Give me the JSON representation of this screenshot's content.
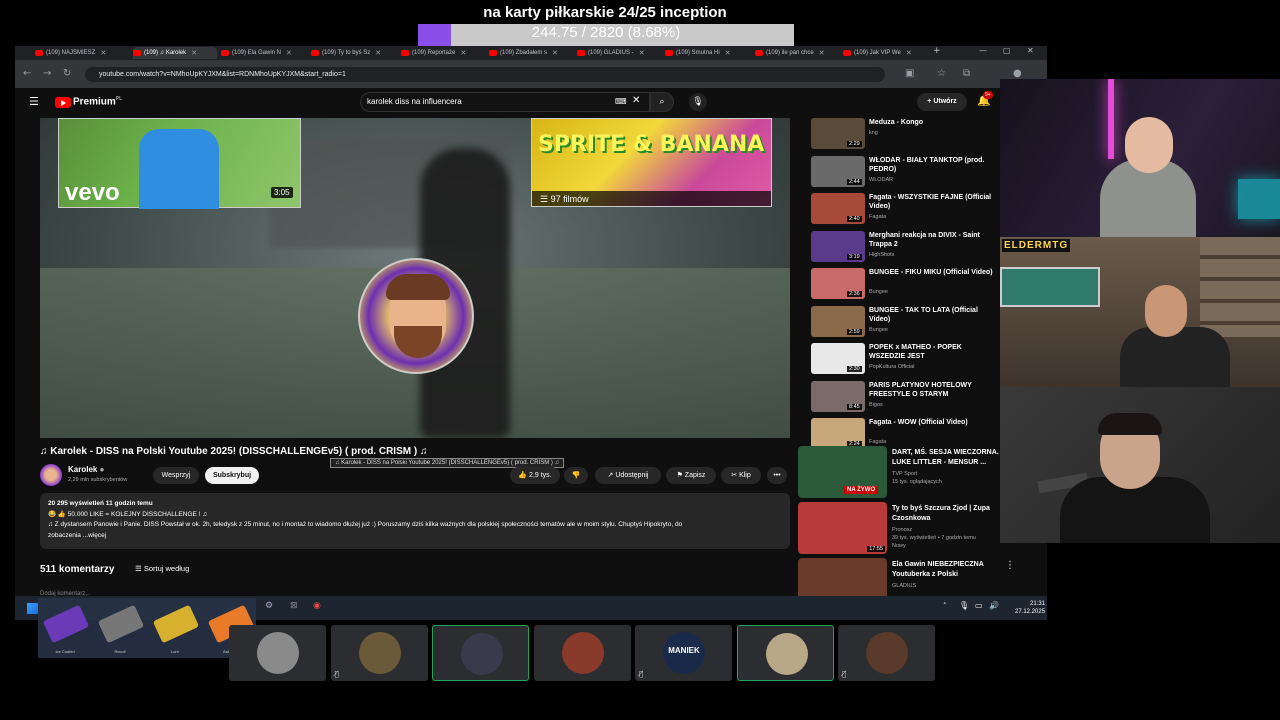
{
  "overlay": {
    "title": "na karty piłkarskie 24/25 inception",
    "goal_text": "244.75 / 2820 (8.68%)",
    "goal_fraction": 0.0868,
    "goal_color": "#8a4fe8"
  },
  "browser": {
    "tabs": [
      {
        "label": "(109) NAJSMIESZ"
      },
      {
        "label": "(109) ♫ Karolek",
        "active": true
      },
      {
        "label": "(109) Ela Gawin N"
      },
      {
        "label": "(109) Ty to byś Sz"
      },
      {
        "label": "(109) Reportaże"
      },
      {
        "label": "(109) Zbadałem s"
      },
      {
        "label": "(109) GLADIUS -"
      },
      {
        "label": "(109) Smutna Hi"
      },
      {
        "label": "(109) ile pan chce"
      },
      {
        "label": "(109) Jak VIP We"
      }
    ],
    "url": "youtube.com/watch?v=NMhoUpKYJXM&list=RDNMhoUpKYJXM&start_radio=1"
  },
  "youtube": {
    "logo_text": "Premium",
    "logo_sup": "PL",
    "search_value": "karolek diss na influencera",
    "create_label": "Utwórz",
    "bell_badge": "9+"
  },
  "video": {
    "endscreen_left_brand": "vevo",
    "endscreen_left_duration": "3:05",
    "endscreen_right_text": "SPRITE & BANANA",
    "endscreen_right_playlist": "97 filmów",
    "title": "♫ Karolek - DISS na Polski Youtube 2025! (DISSCHALLENGEv5) ( prod. CRISM ) ♫",
    "tooltip": "♫ Karolek - DISS na Polski Youtube 2025! (DISSCHALLENGEv5) ( prod. CRISM ) ♫",
    "channel_name": "Karolek",
    "channel_subs": "2,29 mln subskrybentów",
    "support_label": "Wesprzyj",
    "subscribe_label": "Subskrybuj",
    "likes": "2,9 tys.",
    "share_label": "Udostępnij",
    "save_label": "Zapisz",
    "clip_label": "Klip",
    "desc_stats": "20 295 wyświetleń  11 godzin temu",
    "desc_line1": "😂 👍 50.000 LIKE = KOLEJNY DISSCHALLENGE ! ♫",
    "desc_line2": "♫ Z dystansem Panowie i Panie. DISS Powstał w ok. 2h, teledysk z 25 minut, no i montaż to wiadomo dłużej już :) Poruszamy dziś kilka ważnych dla polskiej społeczności tematów ale w moim stylu. Chuptyś Hipokryto, do",
    "desc_line3": "zobaczenia   ...więcej",
    "comments_count": "511 komentarzy",
    "sort_label": "Sortuj według",
    "add_comment": "Dodaj komentarz..."
  },
  "sidebar": {
    "small": [
      {
        "title": "Meduza - Kongo",
        "channel": "kng",
        "duration": "2:29",
        "color": "#5a4a3a"
      },
      {
        "title": "WŁODAR - BIAŁY TANKTOP (prod. PEDRO)",
        "channel": "WLODAR",
        "duration": "2:44",
        "color": "#6a6a6a"
      },
      {
        "title": "Fagata - WSZYSTKIE FAJNE (Official Video)",
        "channel": "Fagata",
        "duration": "2:40",
        "color": "#a84a3a"
      },
      {
        "title": "Merghani reakcja na DIVIX - Saint Trappa 2",
        "channel": "HighShots",
        "duration": "3:19",
        "color": "#5a3a8a"
      },
      {
        "title": "BUNGEE - FIKU MIKU (Official Video)",
        "channel": "Bungee",
        "duration": "2:36",
        "color": "#c86a6a"
      },
      {
        "title": "BUNGEE - TAK TO LATA (Official Video)",
        "channel": "Bungee",
        "duration": "2:59",
        "color": "#8a6a4a"
      },
      {
        "title": "POPEK x MATHEO - POPEK WSZEDZIE JEST",
        "channel": "PopKultura Official",
        "duration": "2:30",
        "color": "#e8e8e8"
      },
      {
        "title": "PARIS PLATYNOV HOTELOWY FREESTYLE O STARYM",
        "channel": "Bigos",
        "duration": "8:45",
        "color": "#7a6a6a"
      },
      {
        "title": "Fagata - WOW (Official Video)",
        "channel": "Fagata",
        "duration": "2:24",
        "color": "#c8a87a"
      }
    ],
    "large": [
      {
        "title": "DART, MŚ. SESJA WIECZORNA. LUKE LITTLER - MENSUR ...",
        "channel": "TVP Sport",
        "meta": "15 tys. oglądających",
        "badge": "NA ŻYWO",
        "color": "#2a5a3a"
      },
      {
        "title": "Ty to byś Szczura Zjod | Zupa Czosnkowa",
        "channel": "Pronosz",
        "meta": "39 tys. wyświetleń • 7 godzin temu",
        "badge2": "Nowy",
        "duration": "17:55",
        "color": "#b83a3a"
      },
      {
        "title": "Ela Gawin NIEBEZPIECZNA Youtuberka z Polski",
        "channel": "GLADIUS",
        "meta": "",
        "color": "#6a3a2a"
      }
    ]
  },
  "taskbar": {
    "time": "21:31",
    "date": "27.12.2025"
  },
  "skins": [
    {
      "label": "Ice Coaled",
      "color": "#6a3ab8"
    },
    {
      "label": "Recoil"
    },
    {
      "label": "Lore",
      "color": "#d8b030"
    },
    {
      "label": "Asiimov",
      "color": "#e87a2a"
    }
  ],
  "discord": [
    {
      "color": "#8a8a8a",
      "muted": false
    },
    {
      "color": "#6a5a3a",
      "muted": true
    },
    {
      "color": "#3a3a4a",
      "muted": false,
      "active": true
    },
    {
      "color": "#8a3a2a",
      "muted": false
    },
    {
      "label": "MANIEK",
      "color": "#1a2a4a",
      "muted": true
    },
    {
      "color": "#b8a888",
      "muted": false,
      "active": true
    },
    {
      "color": "#5a3a2a",
      "muted": true
    }
  ],
  "webcams": {
    "cam2_tag": "ELDERMTG"
  }
}
